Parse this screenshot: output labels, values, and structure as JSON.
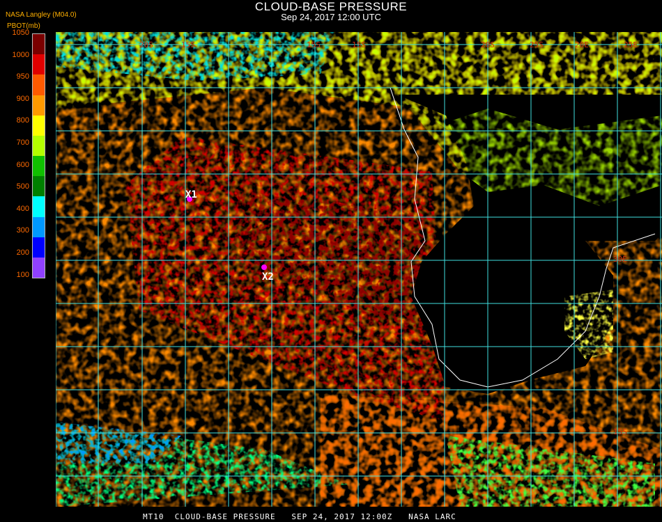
{
  "header": {
    "title": "CLOUD-BASE PRESSURE",
    "subtitle": "Sep 24, 2017 12:00 UTC",
    "credit": "NASA Langley (M04.0)",
    "units": "PBOT(mb)"
  },
  "colorbar": {
    "labels": [
      "1050",
      "1000",
      "950",
      "900",
      "800",
      "700",
      "600",
      "500",
      "400",
      "300",
      "200",
      "100"
    ],
    "colors": [
      "#7a0000",
      "#e00000",
      "#ff5a00",
      "#ff9a00",
      "#ffff00",
      "#b4ff00",
      "#10c000",
      "#008000",
      "#00ffff",
      "#0098ff",
      "#0000ff",
      "#9040ff"
    ]
  },
  "map": {
    "markers": [
      {
        "id": "X1",
        "label": "X1",
        "color": "#ff00ff"
      },
      {
        "id": "X2",
        "label": "X2",
        "color": "#ff00ff"
      }
    ],
    "grid_labels": [
      "20S",
      "15S",
      "15S",
      "20S",
      "25S",
      "20E",
      "25E",
      "30E",
      "15S",
      "15S"
    ],
    "colors": {
      "grid": "#40e0e0",
      "coast": "#ffffff",
      "land_clear": "#000000"
    }
  },
  "footer": {
    "text": "MT10  CLOUD-BASE PRESSURE   SEP 24, 2017 12:00Z   NASA LARC"
  }
}
